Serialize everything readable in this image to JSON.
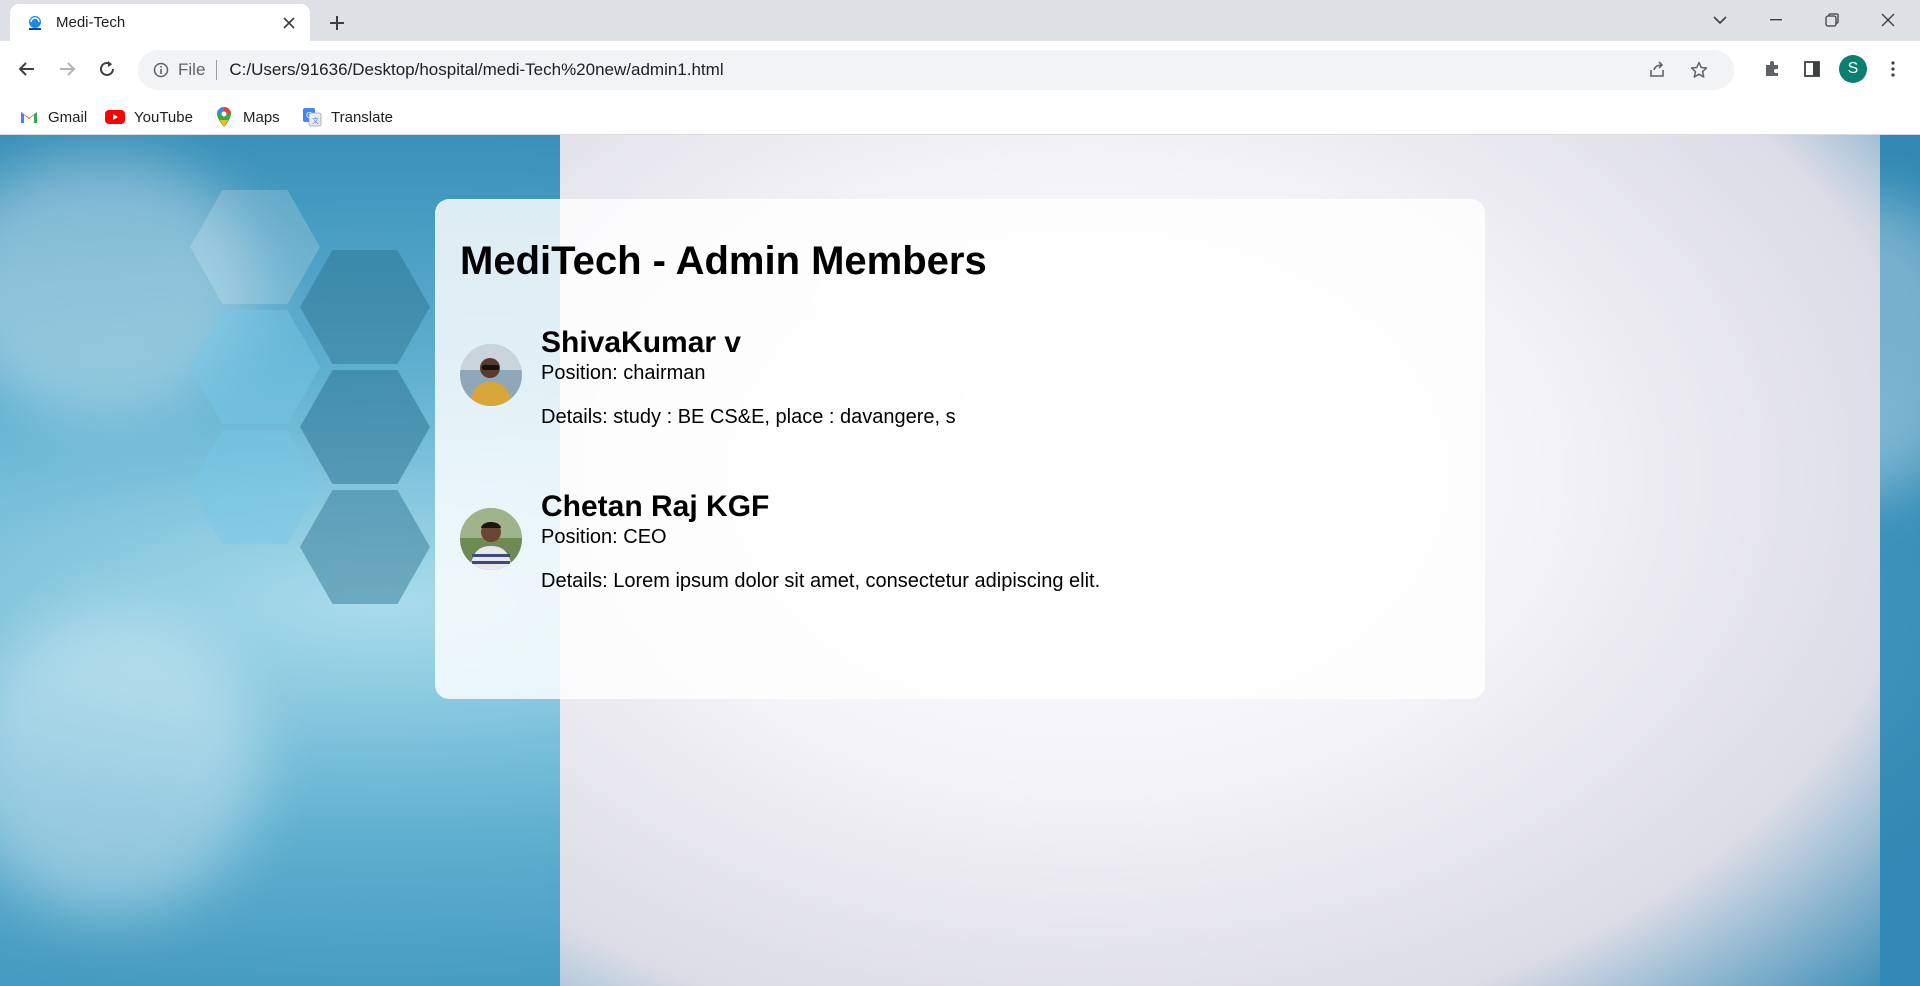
{
  "browser": {
    "tab_title": "Medi-Tech",
    "url_scheme_label": "File",
    "url": "C:/Users/91636/Desktop/hospital/medi-Tech%20new/admin1.html",
    "profile_initial": "S",
    "bookmarks": [
      {
        "label": "Gmail",
        "icon": "gmail-icon"
      },
      {
        "label": "YouTube",
        "icon": "youtube-icon"
      },
      {
        "label": "Maps",
        "icon": "maps-icon"
      },
      {
        "label": "Translate",
        "icon": "translate-icon"
      }
    ]
  },
  "page": {
    "title": "MediTech - Admin Members",
    "members": [
      {
        "name": "ShivaKumar v",
        "position": "Position: chairman",
        "details": "Details: study : BE CS&E, place : davangere, s"
      },
      {
        "name": "Chetan Raj KGF",
        "position": "Position: CEO",
        "details": "Details: Lorem ipsum dolor sit amet, consectetur adipiscing elit."
      }
    ]
  },
  "colors": {
    "accent_profile": "#0b7f72",
    "chrome_bg": "#dee1e6",
    "card_bg": "#ffffff"
  }
}
